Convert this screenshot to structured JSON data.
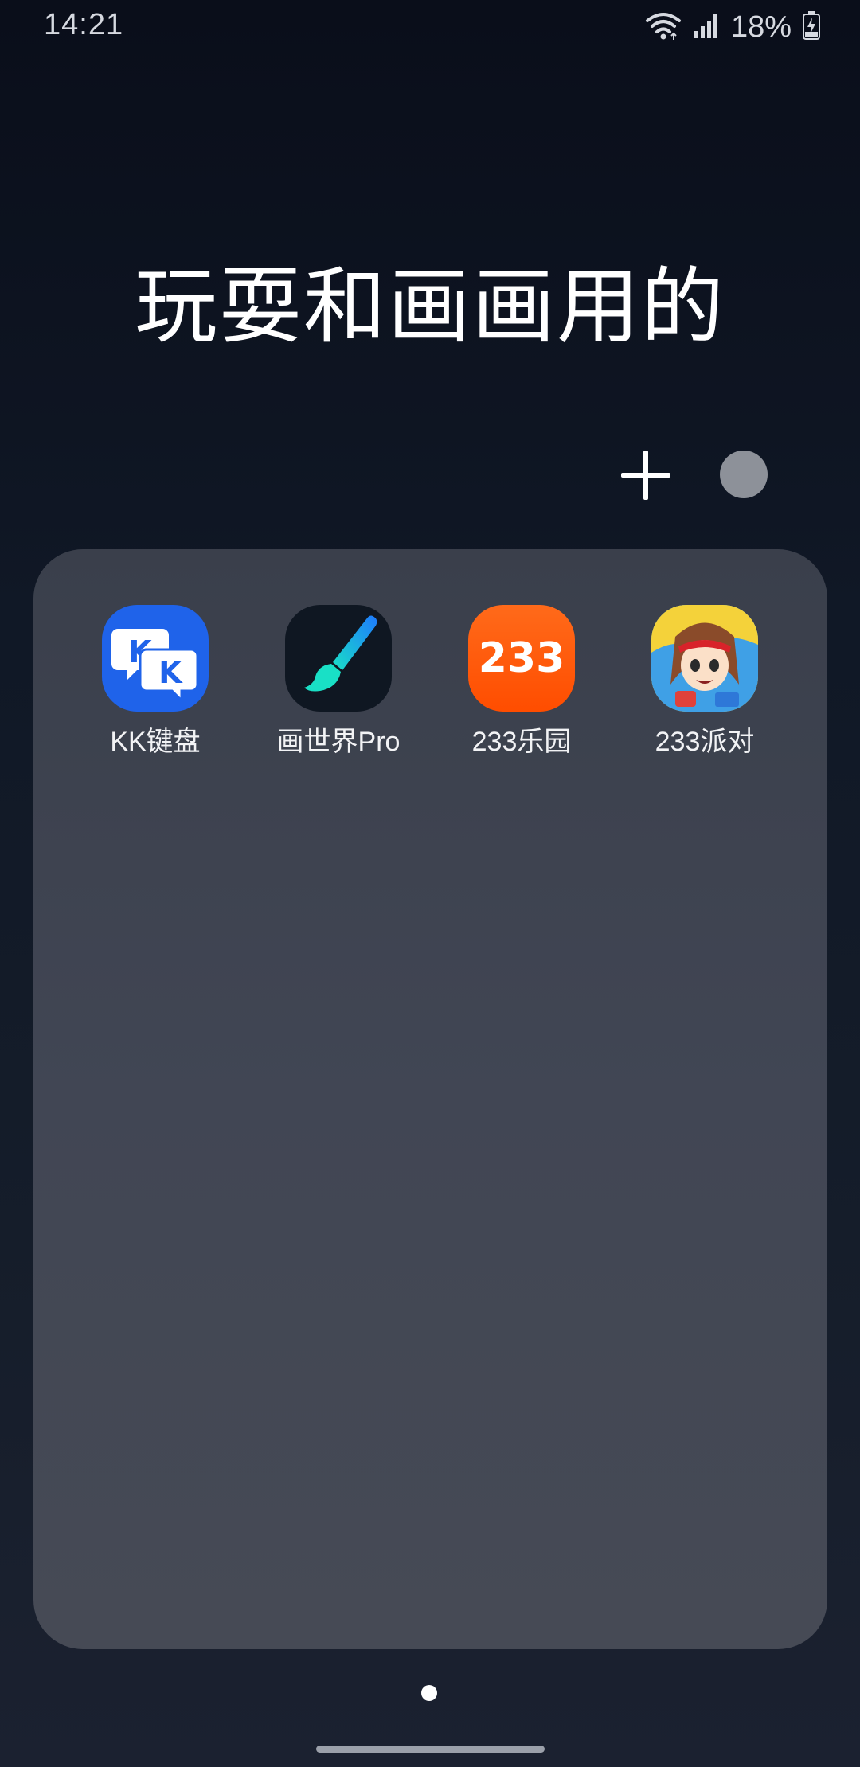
{
  "status_bar": {
    "time": "14:21",
    "battery": "18%",
    "icons": [
      "wifi-icon",
      "signal-icon",
      "battery-charging-icon"
    ]
  },
  "folder": {
    "title": "玩耍和画画用的",
    "add_icon": "plus-icon",
    "color_icon": "folder-color-icon",
    "color": "#8d9199"
  },
  "apps": [
    {
      "label": "KK键盘",
      "icon": "kk-keyboard-icon",
      "color": "#1f63ea"
    },
    {
      "label": "画世界Pro",
      "icon": "brush-icon",
      "color": "#0f1722"
    },
    {
      "label": "233乐园",
      "icon": "233-leyuan-icon",
      "color": "#ff5500",
      "icon_text": "233"
    },
    {
      "label": "233派对",
      "icon": "anime-character-icon",
      "color": "#f1d03a"
    }
  ],
  "pagination": {
    "current": 1,
    "total": 1
  }
}
